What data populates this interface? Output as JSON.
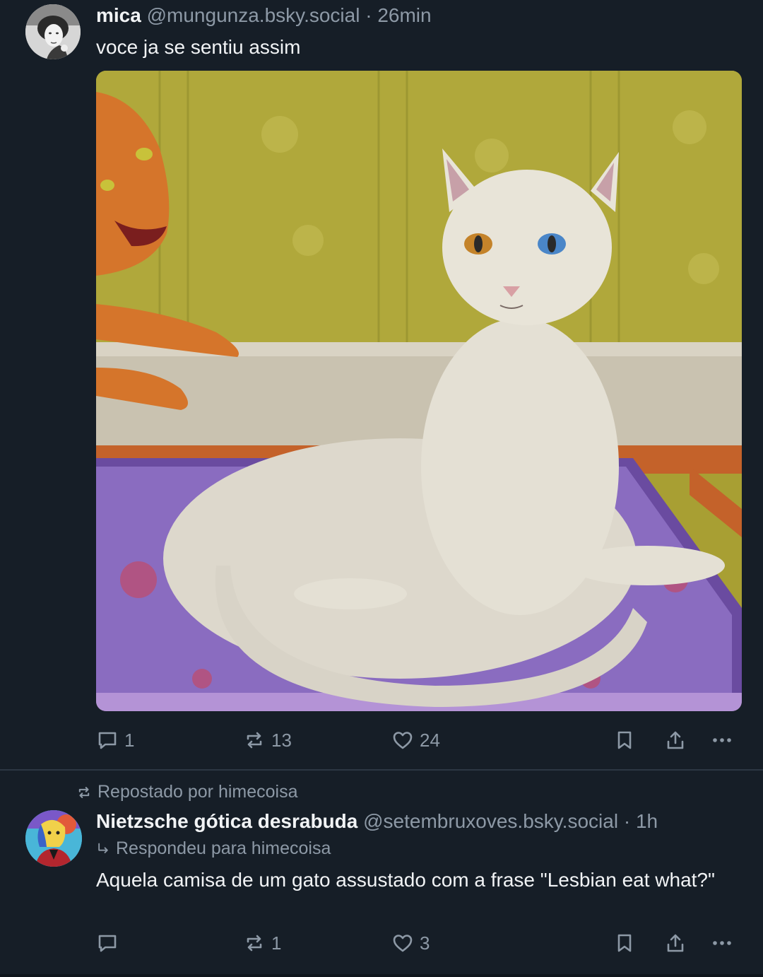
{
  "posts": [
    {
      "author_name": "mica",
      "handle": "@mungunza.bsky.social",
      "separator": "·",
      "time": "26min",
      "text": "voce ja se sentiu assim",
      "image_alt_icon": "painting-white-cat-image",
      "actions": {
        "reply_count": "1",
        "repost_count": "13",
        "like_count": "24"
      }
    },
    {
      "repost_label": "Repostado por himecoisa",
      "author_name": "Nietzsche gótica desrabuda",
      "handle": "@setembruxoves.bsky.social",
      "separator": "·",
      "time": "1h",
      "reply_label": "Respondeu para himecoisa",
      "text": "Aquela camisa de um gato assustado com a frase \"Lesbian eat what?\"",
      "actions": {
        "reply_count": "",
        "repost_count": "1",
        "like_count": "3"
      }
    }
  ],
  "icons": {
    "reply": "speech-bubble-icon",
    "repost": "repost-arrows-icon",
    "like": "heart-icon",
    "bookmark": "bookmark-icon",
    "share": "share-icon",
    "more": "more-dots-icon"
  },
  "colors": {
    "background": "#161e27",
    "muted_text": "#8d99a6",
    "primary_text": "#f1f3f5",
    "divider": "#2c3743"
  }
}
